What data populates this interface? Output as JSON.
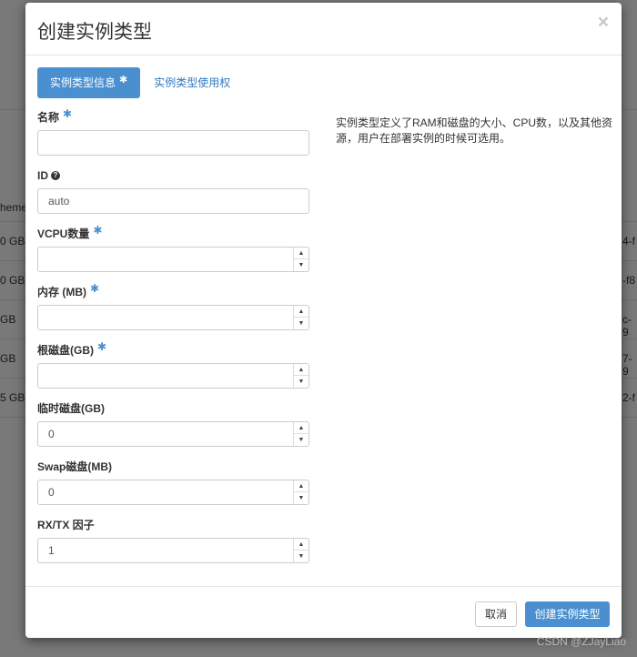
{
  "background": {
    "left_labels": [
      "heme",
      "0 GB",
      "0 GB",
      "GB",
      "GB",
      "5 GB"
    ],
    "right_labels": [
      "4-f",
      "-f8",
      "c-9",
      "7-9",
      "2-f"
    ]
  },
  "modal": {
    "title": "创建实例类型",
    "close": "×",
    "tabs": [
      {
        "label": "实例类型信息",
        "star": "✱"
      },
      {
        "label": "实例类型使用权"
      }
    ],
    "description": "实例类型定义了RAM和磁盘的大小、CPU数，以及其他资源，用户在部署实例的时候可选用。",
    "fields": [
      {
        "label": "名称",
        "required": "✱",
        "value": ""
      },
      {
        "label": "ID",
        "help": "?",
        "value": "auto"
      },
      {
        "label": "VCPU数量",
        "required": "✱",
        "value": ""
      },
      {
        "label": "内存 (MB)",
        "required": "✱",
        "value": ""
      },
      {
        "label": "根磁盘(GB)",
        "required": "✱",
        "value": ""
      },
      {
        "label": "临时磁盘(GB)",
        "value": "0"
      },
      {
        "label": "Swap磁盘(MB)",
        "value": "0"
      },
      {
        "label": "RX/TX 因子",
        "value": "1"
      }
    ],
    "buttons": {
      "cancel": "取消",
      "create": "创建实例类型"
    }
  },
  "watermark": "CSDN @ZJayLiao",
  "colors": {
    "primary": "#4a90d0",
    "link": "#2f7bbf",
    "overlay": "rgba(0,0,0,0.5)"
  }
}
